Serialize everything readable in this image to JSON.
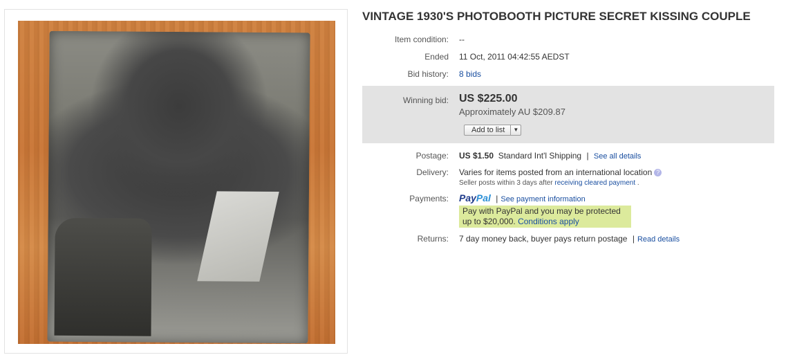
{
  "listing": {
    "title": "VINTAGE 1930'S PHOTOBOOTH PICTURE SECRET KISSING COUPLE"
  },
  "details": {
    "condition_label": "Item condition:",
    "condition_value": "--",
    "ended_label": "Ended",
    "ended_value": "11 Oct, 2011 04:42:55 AEDST",
    "bid_history_label": "Bid history:",
    "bid_history_value": "8 bids"
  },
  "bid": {
    "label": "Winning bid:",
    "price": "US $225.00",
    "approx": "Approximately AU $209.87",
    "add_to_list": "Add to list",
    "dropdown_glyph": "▼"
  },
  "postage": {
    "label": "Postage:",
    "price": "US $1.50",
    "service": "Standard Int'l Shipping",
    "separator": "|",
    "details_link": "See all details"
  },
  "delivery": {
    "label": "Delivery:",
    "value": "Varies for items posted from an international location",
    "help_glyph": "?",
    "note_prefix": "Seller posts within 3 days after",
    "note_link": "receiving cleared payment",
    "note_suffix": "."
  },
  "payments": {
    "label": "Payments:",
    "paypal_pay": "Pay",
    "paypal_pal": "Pal",
    "separator": "|",
    "info_link": "See payment information",
    "protect_line1": "Pay with PayPal and you may be protected",
    "protect_line2_prefix": "up to $20,000.",
    "conditions_link": "Conditions apply"
  },
  "returns": {
    "label": "Returns:",
    "value": "7 day money back, buyer pays return postage",
    "separator": "|",
    "details_link": "Read details"
  },
  "colors": {
    "link": "#1a4fa0",
    "bid_box_bg": "#e3e3e3",
    "paypal_box_bg": "#dcea9c"
  },
  "icons": {
    "help": "help-icon",
    "dropdown": "chevron-down-icon"
  }
}
